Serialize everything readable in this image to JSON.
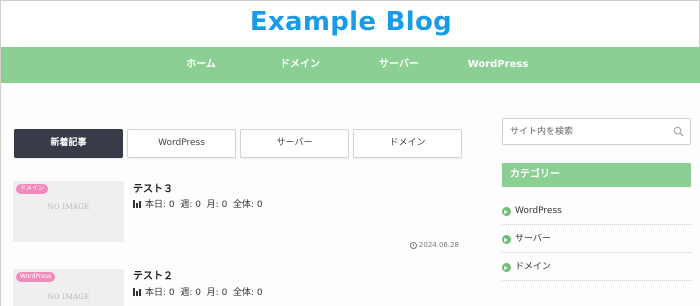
{
  "header": {
    "site_title": "Example Blog"
  },
  "gnav": {
    "items": [
      {
        "label": "ホーム"
      },
      {
        "label": "ドメイン"
      },
      {
        "label": "サーバー"
      },
      {
        "label": "WordPress"
      }
    ]
  },
  "tabs": [
    {
      "label": "新着記事",
      "active": true
    },
    {
      "label": "WordPress",
      "active": false
    },
    {
      "label": "サーバー",
      "active": false
    },
    {
      "label": "ドメイン",
      "active": false
    }
  ],
  "posts": [
    {
      "category": "ドメイン",
      "title": "テスト３",
      "thumb_text": "NO IMAGE",
      "stats": "本日: 0  週: 0  月: 0  全体: 0",
      "date": "2024.06.28",
      "stats_icon": "bar-chart-icon"
    },
    {
      "category": "WordPress",
      "title": "テスト２",
      "thumb_text": "NO IMAGE",
      "stats": "本日: 0  週: 0  月: 0  全体: 0",
      "stats_icon": "bar-chart-icon"
    }
  ],
  "sidebar": {
    "search": {
      "placeholder": "サイト内を検索",
      "icon": "search-icon"
    },
    "category_heading": "カテゴリー",
    "categories": [
      {
        "label": "WordPress"
      },
      {
        "label": "サーバー"
      },
      {
        "label": "ドメイン"
      }
    ]
  },
  "colors": {
    "accent_green": "#8ccf94",
    "title_blue": "#1a9be8",
    "tab_active": "#373b47",
    "badge_pink": "#f08bbb"
  }
}
